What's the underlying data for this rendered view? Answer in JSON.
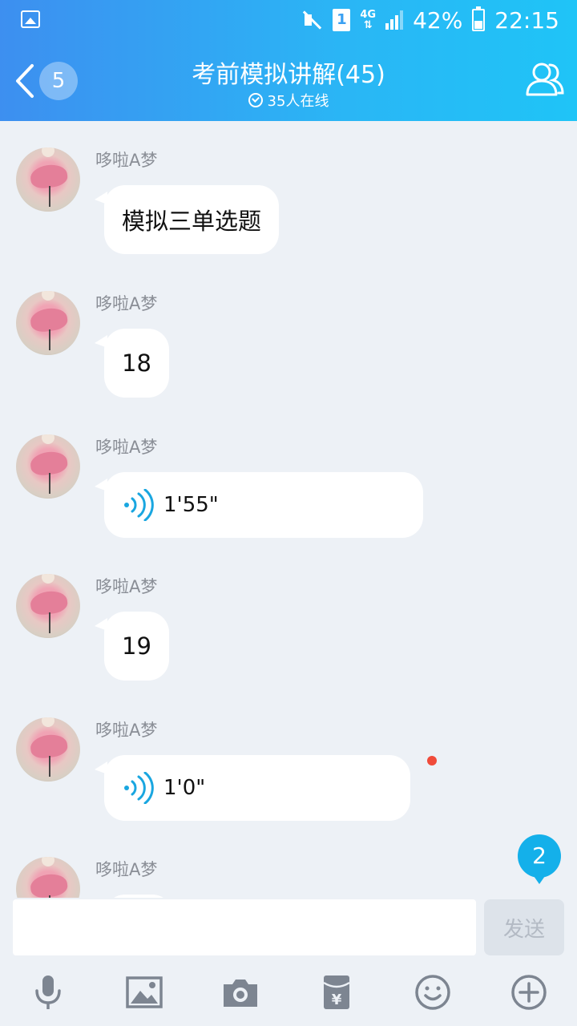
{
  "status_bar": {
    "battery_percent": "42%",
    "time": "22:15",
    "sim": "1",
    "network": "4G",
    "icons": [
      "image-icon",
      "mute-icon",
      "sim-icon",
      "signal-icon",
      "battery-icon"
    ]
  },
  "header": {
    "back_badge": "5",
    "title": "考前模拟讲解(45)",
    "online": "35人在线",
    "accent_colors": [
      "#3d8ff0",
      "#1fc4f7"
    ]
  },
  "messages": [
    {
      "sender": "哆啦A梦",
      "type": "text",
      "content": "模拟三单选题"
    },
    {
      "sender": "哆啦A梦",
      "type": "text",
      "content": "18"
    },
    {
      "sender": "哆啦A梦",
      "type": "voice",
      "content": "1'55\""
    },
    {
      "sender": "哆啦A梦",
      "type": "text",
      "content": "19"
    },
    {
      "sender": "哆啦A梦",
      "type": "voice",
      "content": "1'0\"",
      "unread": true
    },
    {
      "sender": "哆啦A梦",
      "type": "partial"
    }
  ],
  "new_messages_badge": "2",
  "input": {
    "value": "",
    "send_label": "发送"
  },
  "toolbar": [
    "microphone-icon",
    "image-icon",
    "camera-icon",
    "red-packet-icon",
    "emoji-icon",
    "plus-icon"
  ]
}
